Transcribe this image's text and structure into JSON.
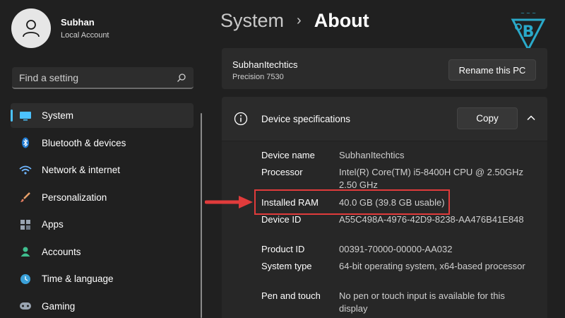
{
  "profile": {
    "name": "Subhan",
    "account_type": "Local Account"
  },
  "search": {
    "placeholder": "Find a setting"
  },
  "nav": {
    "items": [
      {
        "label": "System",
        "icon": "monitor-icon",
        "active": true
      },
      {
        "label": "Bluetooth & devices",
        "icon": "bluetooth-icon"
      },
      {
        "label": "Network & internet",
        "icon": "wifi-icon"
      },
      {
        "label": "Personalization",
        "icon": "brush-icon"
      },
      {
        "label": "Apps",
        "icon": "apps-icon"
      },
      {
        "label": "Accounts",
        "icon": "person-icon"
      },
      {
        "label": "Time & language",
        "icon": "globe-clock-icon"
      },
      {
        "label": "Gaming",
        "icon": "gamepad-icon"
      }
    ]
  },
  "header": {
    "parent": "System",
    "separator": "›",
    "current": "About"
  },
  "pc": {
    "name": "SubhanItechtics",
    "model": "Precision 7530",
    "rename_label": "Rename this PC"
  },
  "specs": {
    "title": "Device specifications",
    "copy_label": "Copy",
    "rows": [
      {
        "label": "Device name",
        "value": "SubhanItechtics"
      },
      {
        "label": "Processor",
        "value": "Intel(R) Core(TM) i5-8400H CPU @ 2.50GHz   2.50 GHz"
      },
      {
        "label": "Installed RAM",
        "value": "40.0 GB (39.8 GB usable)"
      },
      {
        "label": "Device ID",
        "value": "A55C498A-4976-42D9-8238-AA476B41E848"
      },
      {
        "label": "Product ID",
        "value": "00391-70000-00000-AA032"
      },
      {
        "label": "System type",
        "value": "64-bit operating system, x64-based processor"
      },
      {
        "label": "Pen and touch",
        "value": "No pen or touch input is available for this display"
      }
    ]
  },
  "colors": {
    "background": "#202020",
    "card": "#2b2b2b",
    "accent": "#4cc2ff",
    "highlight": "#e03b3b",
    "logo": "#2aa9c9"
  }
}
